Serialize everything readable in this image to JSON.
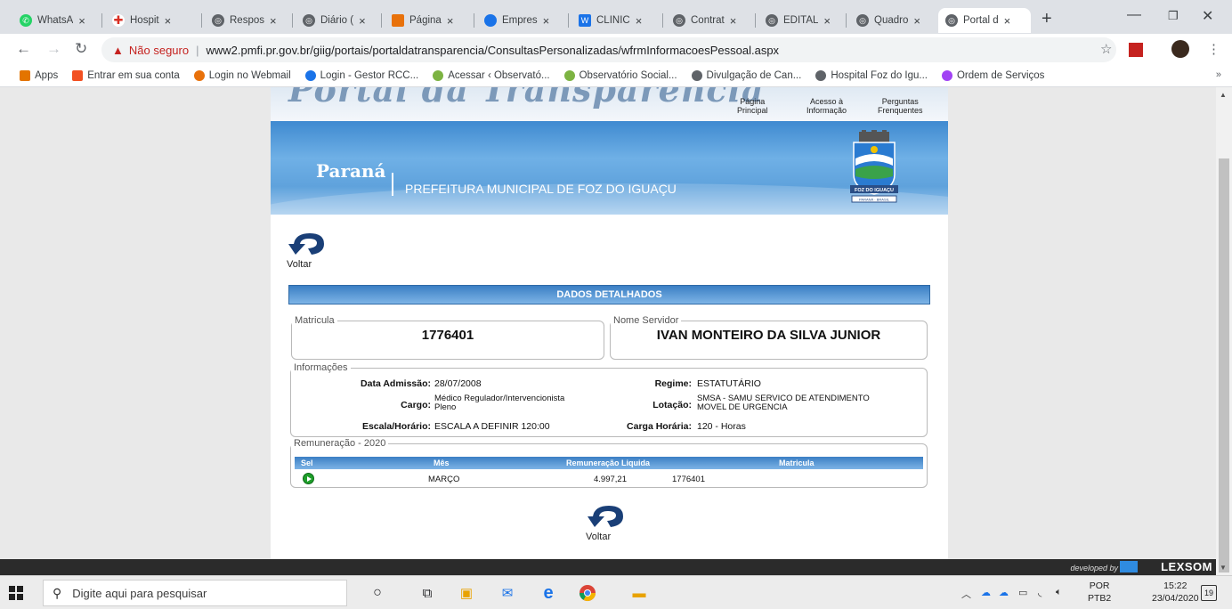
{
  "browser": {
    "tabs": [
      {
        "title": "WhatsA",
        "color": "#25d366"
      },
      {
        "title": "Hospit",
        "color": "#d93025"
      },
      {
        "title": "Respos",
        "color": "#5f6368"
      },
      {
        "title": "Diário (",
        "color": "#5f6368"
      },
      {
        "title": "Página",
        "color": "#e8710a"
      },
      {
        "title": "Empres",
        "color": "#1a73e8"
      },
      {
        "title": "CLINIC",
        "color": "#1a73e8"
      },
      {
        "title": "Contrat",
        "color": "#5f6368"
      },
      {
        "title": "EDITAL",
        "color": "#5f6368"
      },
      {
        "title": "Quadro",
        "color": "#5f6368"
      },
      {
        "title": "Portal d",
        "color": "#5f6368"
      }
    ],
    "address": {
      "security_label": "Não seguro",
      "separator": "|",
      "url": "www2.pmfi.pr.gov.br/giig/portais/portaldatransparencia/ConsultasPersonalizadas/wfrmInformacoesPessoal.aspx"
    },
    "bookmarks": [
      {
        "label": "Apps",
        "color": "#e37400"
      },
      {
        "label": "Entrar em sua conta",
        "color": "#f25022"
      },
      {
        "label": "Login no Webmail",
        "color": "#e8710a"
      },
      {
        "label": "Login - Gestor RCC...",
        "color": "#1a73e8"
      },
      {
        "label": "Acessar ‹ Observató...",
        "color": "#7cb342"
      },
      {
        "label": "Observatório Social...",
        "color": "#7cb342"
      },
      {
        "label": "Divulgação de Can...",
        "color": "#5f6368"
      },
      {
        "label": "Hospital Foz do Igu...",
        "color": "#5f6368"
      },
      {
        "label": "Ordem de Serviços",
        "color": "#a142f4"
      }
    ],
    "bookmarks_more": "»"
  },
  "page": {
    "header_logo": "Portal da Transparência",
    "top_links": [
      {
        "line1": "Página",
        "line2": "Principal"
      },
      {
        "line1": "Acesso à",
        "line2": "Informação"
      },
      {
        "line1": "Perguntas",
        "line2": "Frenquentes"
      }
    ],
    "banner_state": "Paraná",
    "banner_city": "PREFEITURA MUNICIPAL DE FOZ DO IGUAÇU",
    "coat_text": "FOZ DO IGUAÇU",
    "coat_text_2": "PARANÁ · BRASIL",
    "back_label": "Voltar",
    "section_title": "DADOS DETALHADOS",
    "matricula": {
      "legend": "Matricula",
      "value": "1776401"
    },
    "servidor": {
      "legend": "Nome Servidor",
      "value": "IVAN MONTEIRO DA SILVA JUNIOR"
    },
    "info": {
      "legend": "Informações",
      "data_admissao_label": "Data Admissão:",
      "data_admissao": "28/07/2008",
      "regime_label": "Regime:",
      "regime": "ESTATUTÁRIO",
      "cargo_label": "Cargo:",
      "cargo_1": "Médico Regulador/Intervencionista",
      "cargo_2": "Pleno",
      "lotacao_label": "Lotação:",
      "lotacao_1": "SMSA - SAMU SERVICO DE ATENDIMENTO",
      "lotacao_2": "MOVEL DE URGENCIA",
      "escala_label": "Escala/Horário:",
      "escala": "ESCALA A DEFINIR 120:00",
      "carga_label": "Carga Horária:",
      "carga": "120 - Horas"
    },
    "remuneracao": {
      "legend": "Remuneração - 2020",
      "headers": [
        "Sel",
        "Mês",
        "Remuneração Liquida",
        "Matricula"
      ],
      "row": {
        "mes": "MARÇO",
        "valor": "4.997,21",
        "matricula": "1776401"
      }
    },
    "footer_dev": "developed by",
    "footer_brand": "LEXSOM"
  },
  "taskbar": {
    "search_placeholder": "Digite aqui para pesquisar",
    "lang_1": "POR",
    "lang_2": "PTB2",
    "time": "15:22",
    "date": "23/04/2020",
    "notifications": "19"
  }
}
